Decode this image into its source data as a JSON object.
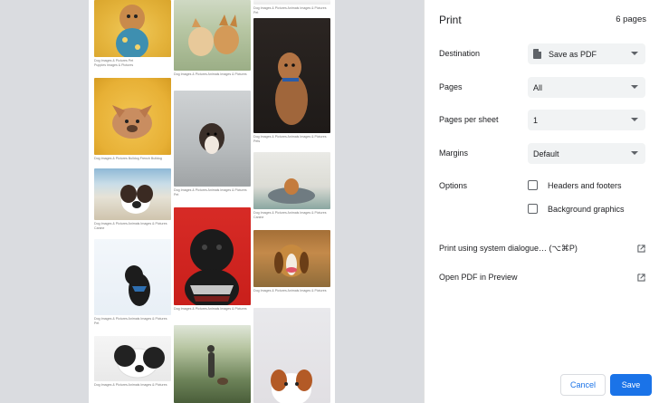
{
  "panel": {
    "title": "Print",
    "page_count": "6 pages",
    "destination": {
      "label": "Destination",
      "value": "Save as PDF"
    },
    "pages": {
      "label": "Pages",
      "value": "All"
    },
    "pages_per_sheet": {
      "label": "Pages per sheet",
      "value": "1"
    },
    "margins": {
      "label": "Margins",
      "value": "Default"
    },
    "options": {
      "label": "Options",
      "headers_footers": {
        "label": "Headers and footers",
        "checked": false
      },
      "background_graphics": {
        "label": "Background graphics",
        "checked": false
      }
    },
    "system_dialogue": "Print using system dialogue… (⌥⌘P)",
    "open_pdf": "Open PDF in Preview",
    "cancel": "Cancel",
    "save": "Save"
  },
  "preview": {
    "captions": {
      "c1": "Dog Images & Pictures   Pet\nPuppies Images & Pictures",
      "c2": "Dog Images & Pictures   Bulldog   French Bulldog",
      "c3": "Dog Images & Pictures   Animals Images & Pictures\nCanine",
      "c4": "Dog Images & Pictures   Animals Images & Pictures\nPet",
      "c5": "Dog Images & Pictures   Animals Images & Pictures",
      "c6": "Dog Images & Pictures   Animals Images & Pictures",
      "c7": "Dog Images & Pictures   Animals Images & Pictures\nPet",
      "c8": "Dog Images & Pictures   Animals Images & Pictures",
      "c9": "Dog Images & Pictures   Animals Images & Pictures\nPet",
      "c10": "Dog Images & Pictures   Animals Images & Pictures\nPets",
      "c11": "Dog Images & Pictures   Animals Images & Pictures\nCanine",
      "c12": "Dog Images & Pictures   Animals Images & Pictures"
    }
  }
}
